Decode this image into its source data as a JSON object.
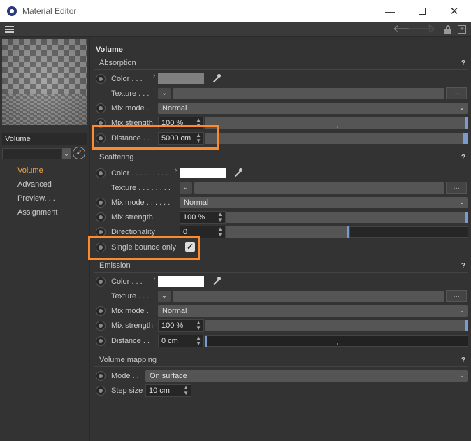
{
  "window": {
    "title": "Material Editor",
    "min": "—",
    "close": "✕"
  },
  "toolbar": {
    "back": "🡐",
    "forward": "🡒",
    "up": "🡑",
    "new": "+"
  },
  "left": {
    "material_name": "Volume",
    "nav": [
      {
        "label": "Volume",
        "active": true
      },
      {
        "label": "Advanced",
        "active": false
      },
      {
        "label": "Preview. . .",
        "active": false
      },
      {
        "label": "Assignment",
        "active": false
      }
    ]
  },
  "main": {
    "section_title": "Volume",
    "absorption": {
      "title": "Absorption",
      "help": "?",
      "color_label": "Color . . .",
      "texture_label": "Texture . . .",
      "texture_btn": "...",
      "mix_mode_label": "Mix mode .",
      "mix_mode_value": "Normal",
      "mix_strength_label": "Mix strength",
      "mix_strength_value": "100 %",
      "distance_label": "Distance . .",
      "distance_value": "5000 cm"
    },
    "scattering": {
      "title": "Scattering",
      "help": "?",
      "color_label": "Color . . . . . . . . .",
      "texture_label": "Texture . . . . . . . .",
      "texture_btn": "...",
      "mix_mode_label": "Mix mode . . . . . .",
      "mix_mode_value": "Normal",
      "mix_strength_label": "Mix strength",
      "mix_strength_value": "100 %",
      "directionality_label": "Directionality",
      "directionality_value": "0",
      "single_bounce_label": "Single bounce only",
      "single_bounce_checked": true
    },
    "emission": {
      "title": "Emission",
      "help": "?",
      "color_label": "Color . . .",
      "texture_label": "Texture . . .",
      "texture_btn": "...",
      "mix_mode_label": "Mix mode .",
      "mix_mode_value": "Normal",
      "mix_strength_label": "Mix strength",
      "mix_strength_value": "100 %",
      "distance_label": "Distance . .",
      "distance_value": "0 cm"
    },
    "volume_mapping": {
      "title": "Volume mapping",
      "help": "?",
      "mode_label": "Mode . .",
      "mode_value": "On surface",
      "step_size_label": "Step size",
      "step_size_value": "10 cm"
    }
  },
  "colors": {
    "highlight": "#ff8a2a",
    "accent": "#f0a44a",
    "slider_knob": "#7a9ad0"
  },
  "levels": {
    "absorption_mix_strength": 1.0,
    "absorption_distance": 1.0,
    "scattering_mix_strength": 1.0,
    "scattering_directionality": 0.5,
    "emission_mix_strength": 1.0,
    "emission_distance": 0.0
  }
}
